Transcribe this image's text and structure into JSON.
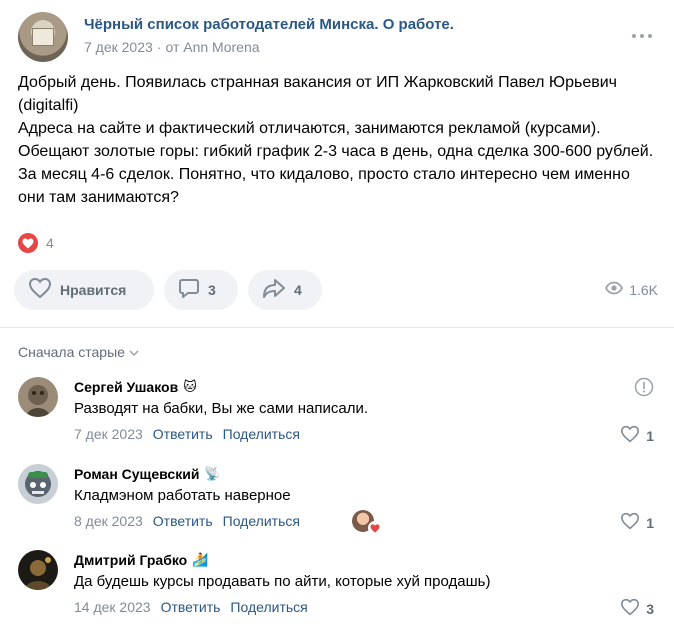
{
  "post": {
    "group_name": "Чёрный список работодателей Минска. О работе.",
    "date": "7 дек 2023",
    "author_prefix": "от",
    "author": "Ann Morena",
    "text": [
      "Добрый день. Появилась странная вакансия от ИП Жарковский Павел Юрьевич (digitalfi)",
      "Адреса на сайте и фактический отличаются, занимаются рекламой (курсами). Обещают золотые горы: гибкий график 2-3 часа в день, одна сделка 300-600 рублей. За месяц 4-6 сделок. Понятно, что кидалово, просто стало интересно чем именно они там занимаются?"
    ],
    "reaction_count": "4",
    "like_label": "Нравится",
    "comments_count": "3",
    "shares_count": "4",
    "views": "1.6K"
  },
  "sort_label": "Сначала старые",
  "comments": [
    {
      "name": "Сергей Ушаков",
      "badge": "🐱",
      "text": "Разводят на бабки, Вы же сами написали.",
      "date": "7 дек 2023",
      "reply": "Ответить",
      "share": "Поделиться",
      "likes": "1"
    },
    {
      "name": "Роман Сущевский",
      "badge": "📡",
      "text": "Кладмэном работать наверное",
      "date": "8 дек 2023",
      "reply": "Ответить",
      "share": "Поделиться",
      "likes": "1"
    },
    {
      "name": "Дмитрий Грабко",
      "badge": "🏄",
      "text": "Да будешь курсы продавать по айти, которые хуй продашь)",
      "date": "14 дек 2023",
      "reply": "Ответить",
      "share": "Поделиться",
      "likes": "3"
    }
  ],
  "colors": {
    "link": "#2a5885",
    "meta": "#818c99",
    "button_bg": "#f0f2f5",
    "heart": "#e64646"
  },
  "icons": [
    "more-icon",
    "heart-icon",
    "comment-icon",
    "share-icon",
    "eye-icon",
    "chevron-down-icon",
    "report-icon"
  ]
}
